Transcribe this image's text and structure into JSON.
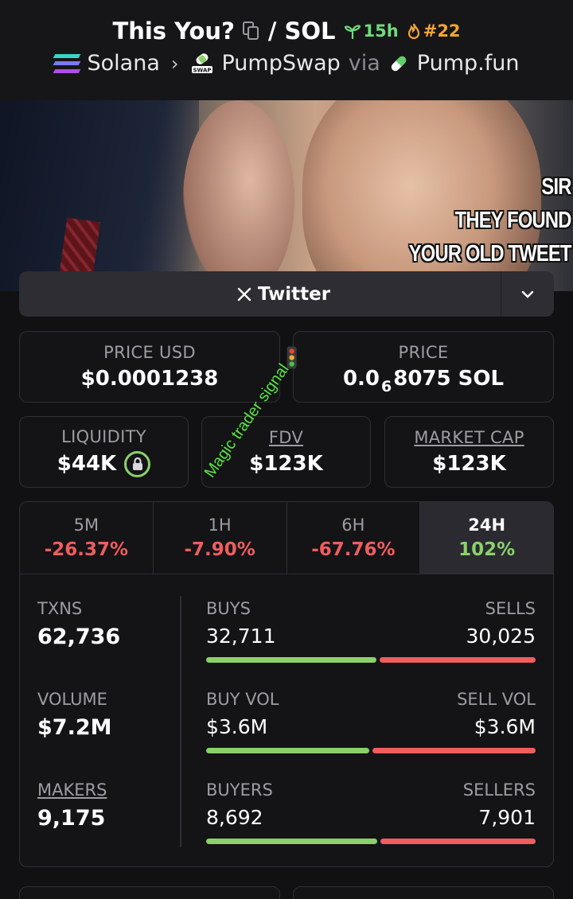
{
  "header": {
    "token_name": "This You?",
    "separator": "/",
    "quote": "SOL",
    "age": "15h",
    "rank": "#22",
    "chain": "Solana",
    "dex": "PumpSwap",
    "via": "via",
    "launchpad": "Pump.fun",
    "colors": {
      "age": "#6fdc7a",
      "rank": "#f2a533"
    }
  },
  "banner": {
    "meme_lines": [
      "SIR",
      "THEY FOUND",
      "YOUR OLD TWEET"
    ]
  },
  "social": {
    "twitter_icon": "x-logo-icon",
    "twitter_label": "Twitter"
  },
  "stats": {
    "price_usd": {
      "label": "PRICE USD",
      "value": "$0.0001238"
    },
    "price": {
      "label": "PRICE",
      "value_prefix": "0.0",
      "value_sub": "6",
      "value_suffix": "8075 SOL"
    },
    "liquidity": {
      "label": "LIQUIDITY",
      "value": "$44K"
    },
    "fdv": {
      "label": "FDV",
      "value": "$123K"
    },
    "market_cap": {
      "label": "MARKET CAP",
      "value": "$123K"
    }
  },
  "overlay": {
    "text": "Magic trader signal"
  },
  "timeframes": [
    {
      "label": "5M",
      "change": "-26.37%"
    },
    {
      "label": "1H",
      "change": "-7.90%"
    },
    {
      "label": "6H",
      "change": "-67.76%"
    },
    {
      "label": "24H",
      "change": "102%"
    }
  ],
  "activity": {
    "txns": {
      "label": "TXNS",
      "value": "62,736"
    },
    "volume": {
      "label": "VOLUME",
      "value": "$7.2M"
    },
    "makers": {
      "label": "MAKERS",
      "value": "9,175"
    },
    "buys_sells": {
      "left_label": "BUYS",
      "right_label": "SELLS",
      "left": "32,711",
      "right": "30,025",
      "buy_share": 0.521
    },
    "vol": {
      "left_label": "BUY VOL",
      "right_label": "SELL VOL",
      "left": "$3.6M",
      "right": "$3.6M",
      "buy_share": 0.5
    },
    "buyers_sellers": {
      "left_label": "BUYERS",
      "right_label": "SELLERS",
      "left": "8,692",
      "right": "7,901",
      "buy_share": 0.524
    }
  },
  "colors": {
    "positive": "#8bd16a",
    "negative": "#ef5d5d",
    "panel_bg": "#141417"
  }
}
